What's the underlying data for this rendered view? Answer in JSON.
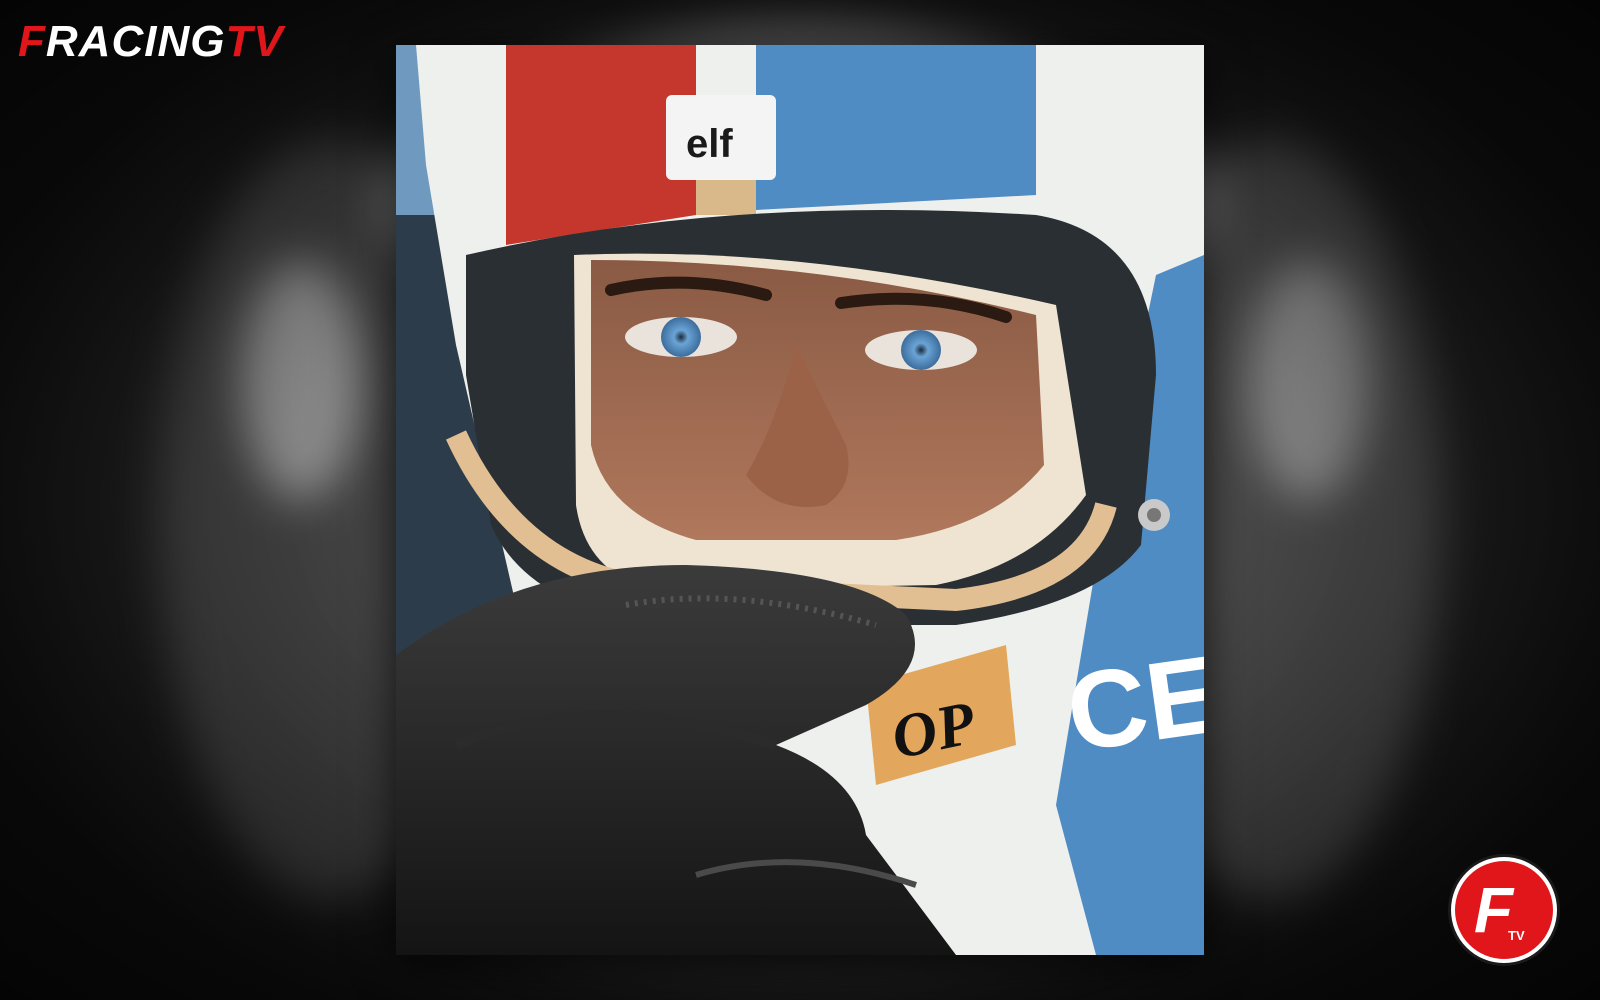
{
  "brand": {
    "logo_text": "FRACINGTV",
    "logo_name": "F RACING TV",
    "accent_color": "#e0161b"
  },
  "photo": {
    "subject_icon": "helmeted-driver-portrait",
    "helmet_sponsor_1": "elf",
    "helmet_sponsor_2": "OP",
    "helmet_sponsor_3": "CE",
    "helmet_colors": {
      "red": "#c5362c",
      "blue": "#4f8cc4",
      "white": "#eef0ee",
      "cream": "#e8c9a1"
    }
  },
  "badge": {
    "letter": "F",
    "subtext": "TV",
    "color": "#e0161b"
  }
}
